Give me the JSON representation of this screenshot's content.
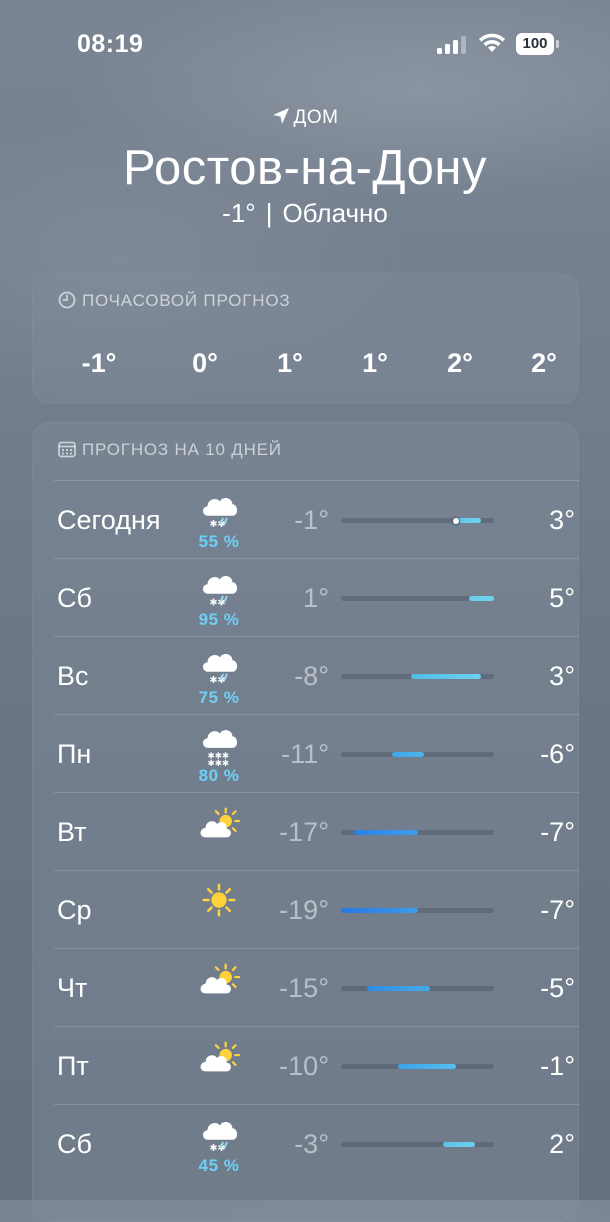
{
  "status_bar": {
    "time": "08:19",
    "battery": "100",
    "icons": [
      "signal-icon",
      "wifi-icon",
      "battery-icon"
    ]
  },
  "header": {
    "location_label": "ДОМ",
    "location_icon": "location-arrow-icon",
    "city": "Ростов-на-Дону",
    "current_temp": "-1°",
    "separator": "|",
    "condition": "Облачно"
  },
  "hourly": {
    "title": "ПОЧАСОВОЙ ПРОГНОЗ",
    "icon": "clock-icon",
    "temps": [
      "-1°",
      "0°",
      "1°",
      "1°",
      "2°",
      "2°"
    ]
  },
  "daily": {
    "title": "ПРОГНОЗ НА 10 ДНЕЙ",
    "icon": "calendar-icon",
    "range": {
      "min": -19,
      "max": 5
    },
    "days": [
      {
        "name": "Сегодня",
        "icon": "snow-cloud-icon",
        "precip": "55 %",
        "low": "-1°",
        "high": "3°",
        "low_value": -1,
        "high_value": 3,
        "current_value": -1,
        "color_from": "#5fc8e8",
        "color_to": "#6fd3ef"
      },
      {
        "name": "Сб",
        "icon": "snow-cloud-icon",
        "precip": "95 %",
        "low": "1°",
        "high": "5°",
        "low_value": 1,
        "high_value": 5,
        "color_from": "#66cdea",
        "color_to": "#72d4ee"
      },
      {
        "name": "Вс",
        "icon": "snow-cloud-icon",
        "precip": "75 %",
        "low": "-8°",
        "high": "3°",
        "low_value": -8,
        "high_value": 3,
        "color_from": "#50bde9",
        "color_to": "#6cd1ee"
      },
      {
        "name": "Пн",
        "icon": "snow-heavy-icon",
        "precip": "80 %",
        "low": "-11°",
        "high": "-6°",
        "low_value": -11,
        "high_value": -6,
        "color_from": "#3fa6ea",
        "color_to": "#4cb5ea"
      },
      {
        "name": "Вт",
        "icon": "partly-sunny-icon",
        "precip": "",
        "low": "-17°",
        "high": "-7°",
        "low_value": -17,
        "high_value": -7,
        "color_from": "#2a7fe6",
        "color_to": "#3e9fe9"
      },
      {
        "name": "Ср",
        "icon": "sun-icon",
        "precip": "",
        "low": "-19°",
        "high": "-7°",
        "low_value": -19,
        "high_value": -7,
        "color_from": "#2876e4",
        "color_to": "#3c9de9"
      },
      {
        "name": "Чт",
        "icon": "partly-sunny-icon",
        "precip": "",
        "low": "-15°",
        "high": "-5°",
        "low_value": -15,
        "high_value": -5,
        "color_from": "#2f8ce7",
        "color_to": "#45aae9"
      },
      {
        "name": "Пт",
        "icon": "partly-sunny-icon",
        "precip": "",
        "low": "-10°",
        "high": "-1°",
        "low_value": -10,
        "high_value": -1,
        "color_from": "#3ca2ea",
        "color_to": "#56bfea"
      },
      {
        "name": "Сб",
        "icon": "snow-cloud-icon",
        "precip": "45 %",
        "low": "-3°",
        "high": "2°",
        "low_value": -3,
        "high_value": 2,
        "color_from": "#5ac4ea",
        "color_to": "#6ccfee"
      }
    ]
  }
}
